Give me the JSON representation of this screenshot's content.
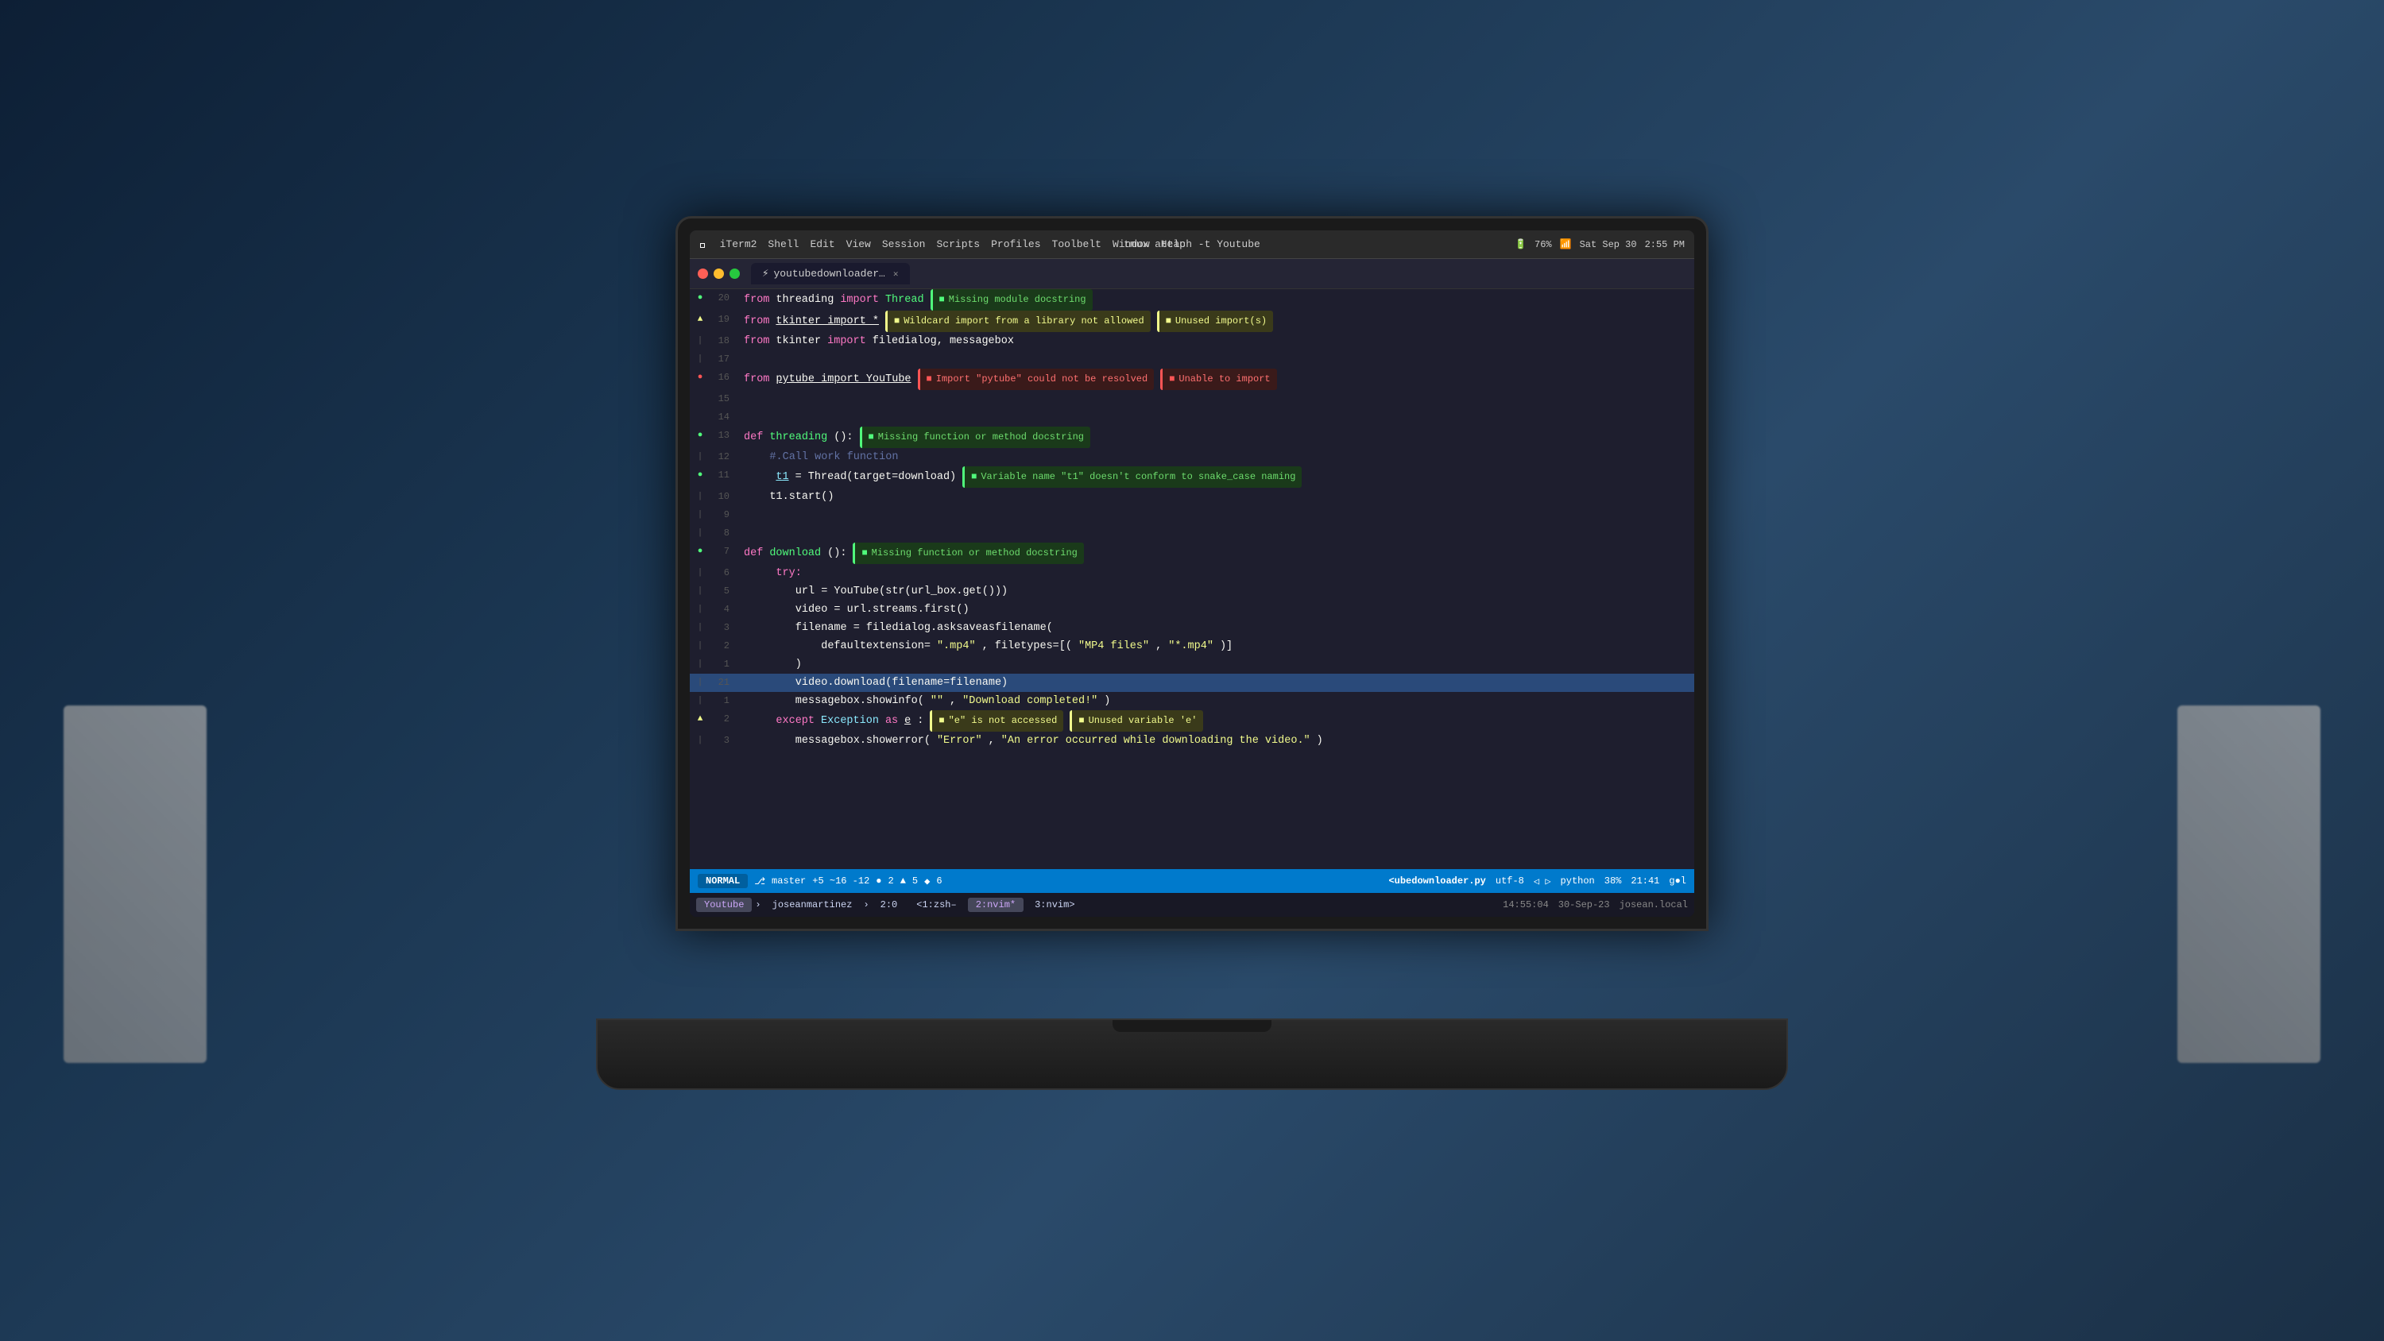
{
  "window": {
    "title": "tmux attach -t Youtube",
    "app": "iTerm2"
  },
  "menubar": {
    "apple": "&#63743;",
    "items": [
      "iTerm2",
      "Shell",
      "Edit",
      "View",
      "Session",
      "Scripts",
      "Profiles",
      "Toolbelt",
      "Window",
      "Help"
    ],
    "right": [
      "76%",
      "Sat Sep 30",
      "2:55 PM"
    ],
    "title": "tmux attach -t Youtube"
  },
  "tab": {
    "label": "youtubedownloader…",
    "close": "✕"
  },
  "lines": [
    {
      "num": "20",
      "indicator": "●",
      "ind_class": "ind-green",
      "code": "from threading import Thread",
      "hints": [
        {
          "text": "Missing module docstring",
          "type": "green"
        }
      ]
    },
    {
      "num": "19",
      "indicator": "▲",
      "ind_class": "ind-yellow",
      "code": "from tkinter import *",
      "hints": [
        {
          "text": "Wildcard import from a library not allowed",
          "type": "yellow"
        },
        {
          "text": "Unused import(s)",
          "type": "yellow"
        }
      ]
    },
    {
      "num": "18",
      "indicator": "|",
      "ind_class": "ind-pipe",
      "code": "from tkinter import filedialog, messagebox",
      "hints": []
    },
    {
      "num": "17",
      "indicator": "|",
      "ind_class": "ind-pipe",
      "code": "",
      "hints": []
    },
    {
      "num": "16",
      "indicator": "●",
      "ind_class": "ind-red",
      "code": "from pytube import YouTube",
      "hints": [
        {
          "text": "Import \"pytube\" could not be resolved",
          "type": "red"
        },
        {
          "text": "Unable to import",
          "type": "red"
        }
      ]
    },
    {
      "num": "15",
      "indicator": "",
      "ind_class": "",
      "code": "",
      "hints": []
    },
    {
      "num": "14",
      "indicator": "",
      "ind_class": "",
      "code": "",
      "hints": []
    },
    {
      "num": "13",
      "indicator": "●",
      "ind_class": "ind-green",
      "code": "def threading():",
      "hints": [
        {
          "text": "Missing function or method docstring",
          "type": "green"
        }
      ]
    },
    {
      "num": "12",
      "indicator": "|",
      "ind_class": "ind-pipe",
      "code": "    #.Call work function",
      "hints": []
    },
    {
      "num": "11",
      "indicator": "●",
      "ind_class": "ind-green",
      "code": "    t1 = Thread(target=download)",
      "hints": [
        {
          "text": "Variable name \"t1\" doesn't conform to snake_case naming",
          "type": "green"
        }
      ]
    },
    {
      "num": "10",
      "indicator": "|",
      "ind_class": "ind-pipe",
      "code": "    t1.start()",
      "hints": []
    },
    {
      "num": "9",
      "indicator": "|",
      "ind_class": "ind-pipe",
      "code": "",
      "hints": []
    },
    {
      "num": "8",
      "indicator": "|",
      "ind_class": "ind-pipe",
      "code": "",
      "hints": []
    },
    {
      "num": "7",
      "indicator": "●",
      "ind_class": "ind-green",
      "code": "def download():",
      "hints": [
        {
          "text": "Missing function or method docstring",
          "type": "green"
        }
      ]
    },
    {
      "num": "6",
      "indicator": "|",
      "ind_class": "ind-pipe",
      "code": "    try:",
      "hints": []
    },
    {
      "num": "5",
      "indicator": "|",
      "ind_class": "ind-pipe",
      "code": "        url = YouTube(str(url_box.get()))",
      "hints": []
    },
    {
      "num": "4",
      "indicator": "|",
      "ind_class": "ind-pipe",
      "code": "        video = url.streams.first()",
      "hints": []
    },
    {
      "num": "3",
      "indicator": "|",
      "ind_class": "ind-pipe",
      "code": "        filename = filedialog.asksaveasfilename(",
      "hints": []
    },
    {
      "num": "2",
      "indicator": "|",
      "ind_class": "ind-pipe",
      "code": "            defaultextension=\".mp4\", filetypes=[(\"MP4 files\", \"*.mp4\")]",
      "hints": []
    },
    {
      "num": "1",
      "indicator": "|",
      "ind_class": "ind-pipe",
      "code": "        )",
      "hints": []
    },
    {
      "num": "21",
      "indicator": "|",
      "ind_class": "ind-pipe",
      "code": "        video.download(filename=filename)",
      "hints": [],
      "highlighted": true
    },
    {
      "num": "1",
      "indicator": "|",
      "ind_class": "ind-pipe",
      "code": "        messagebox.showinfo(\"\", \"Download completed!\")",
      "hints": []
    },
    {
      "num": "2",
      "indicator": "▲",
      "ind_class": "ind-yellow",
      "code": "    except Exception as e:",
      "hints": [
        {
          "text": "\"e\" is not accessed",
          "type": "yellow"
        },
        {
          "text": "Unused variable 'e'",
          "type": "yellow"
        }
      ]
    },
    {
      "num": "3",
      "indicator": "|",
      "ind_class": "ind-pipe",
      "code": "        messagebox.showerror(\"Error\", \"An error occurred while downloading the video.\")",
      "hints": []
    }
  ],
  "statusbar": {
    "mode": "NORMAL",
    "git_branch": "master",
    "git_stats": "+5 ~16 -12",
    "errors": "2",
    "warnings": "5",
    "hints_count": "6",
    "filename": "<ubedownloader.py",
    "encoding": "utf-8",
    "filetype": "python",
    "scroll": "38%",
    "position": "21:41",
    "extra": "g●l"
  },
  "tmux": {
    "windows": [
      {
        "label": "Youtube",
        "active": true
      },
      {
        "label": "joseanmartinez"
      },
      {
        "label": "2:0"
      },
      {
        "label": "<1:zsh–"
      },
      {
        "label": "2:nvim*",
        "active2": true
      },
      {
        "label": "3:nvim>"
      }
    ],
    "time": "14:55:04",
    "date": "30-Sep-23",
    "host": "josean.local"
  }
}
